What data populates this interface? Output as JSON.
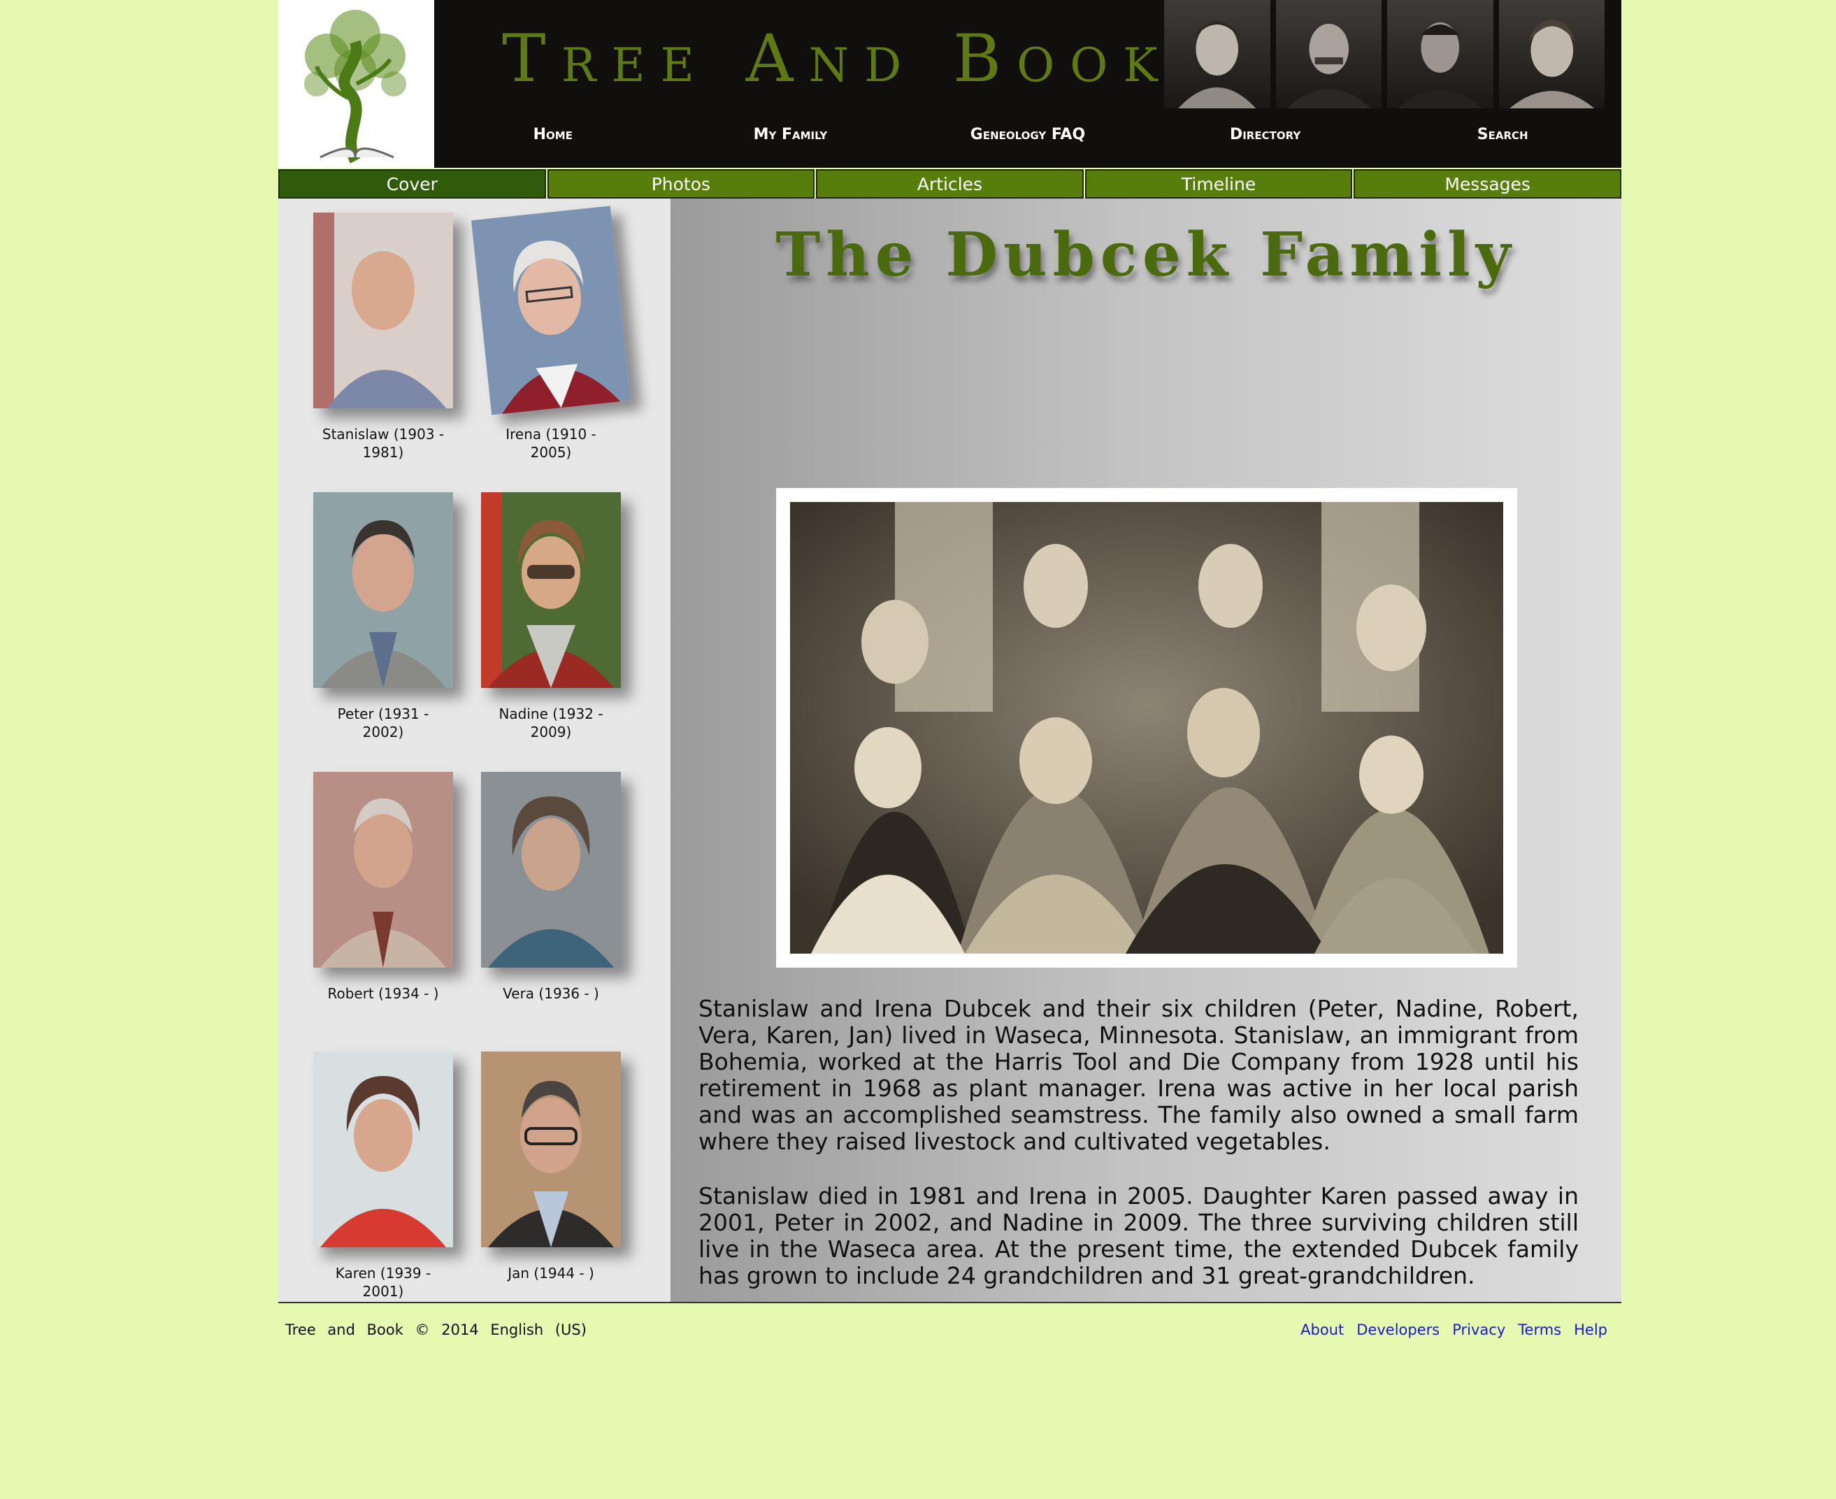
{
  "header": {
    "site_title": "Tree And Book",
    "nav": [
      "Home",
      "My Family",
      "Geneology FAQ",
      "Directory",
      "Search"
    ]
  },
  "tabs": [
    "Cover",
    "Photos",
    "Articles",
    "Timeline",
    "Messages"
  ],
  "sidebar": {
    "people": [
      {
        "caption": "Stanislaw (1903 - 1981)"
      },
      {
        "caption": "Irena (1910 - 2005)"
      },
      {
        "caption": "Peter (1931 - 2002)"
      },
      {
        "caption": "Nadine (1932 - 2009)"
      },
      {
        "caption": "Robert (1934 - )"
      },
      {
        "caption": "Vera (1936 - )"
      },
      {
        "caption": "Karen (1939 - 2001)"
      },
      {
        "caption": "Jan (1944 - )"
      }
    ]
  },
  "main": {
    "title": "The Dubcek Family",
    "paragraphs": [
      "Stanislaw and Irena Dubcek and their six children (Peter, Nadine, Robert, Vera, Karen, Jan) lived in Waseca, Minnesota. Stanislaw, an immigrant from Bohemia, worked at the Harris Tool and Die Company from 1928 until his retirement in 1968 as plant manager. Irena was active in her local parish and was an accomplished seamstress. The family also owned a small farm where they raised livestock and cultivated vegetables.",
      "Stanislaw died in 1981 and Irena in 2005. Daughter Karen passed away in 2001, Peter in 2002, and Nadine in 2009. The three surviving children still live in the Waseca area. At the present time, the extended Dubcek family has grown to include 24 grandchildren and 31 great-grandchildren."
    ]
  },
  "footer": {
    "copyright": "Tree and Book © 2014 English (US)",
    "links": [
      "About",
      "Developers",
      "Privacy",
      "Terms",
      "Help"
    ]
  },
  "colors": {
    "page_bg": "#e5f9b0",
    "header_bg": "#110f0d",
    "tab_green": "#577e0b",
    "tab_active": "#2f5b0b",
    "title_green": "#4b6a0d"
  }
}
